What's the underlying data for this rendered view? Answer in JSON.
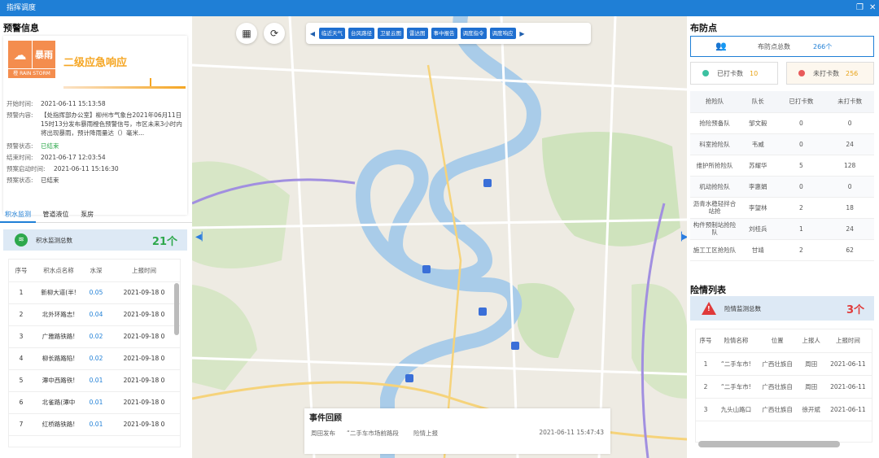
{
  "window": {
    "title": "指挥调度"
  },
  "warning": {
    "section_title": "预警信息",
    "badge_rain": "暴雨",
    "badge_level": "橙",
    "badge_caption": "RAIN STORM",
    "response_title": "二级应急响应",
    "rows": [
      {
        "label": "开始时间:",
        "value": "2021-06-11 15:13:58"
      },
      {
        "label": "预警内容:",
        "value": ""
      },
      {
        "label": "预警状态:",
        "value": "已结束"
      },
      {
        "label": "结束时间:",
        "value": "2021-06-17 12:03:54"
      },
      {
        "label": "预案启动时间:",
        "value": "2021-06-11 15:16:30"
      },
      {
        "label": "预案状态:",
        "value": "已结束"
      }
    ],
    "content": "【处指挥部办公室】柳州市气象台2021年06月11日15时13分发布暴雨橙色预警信号，市区未来3小时内将出现暴雨，预计降雨量达（）毫米..."
  },
  "tabs": [
    {
      "label": "积水监测",
      "active": true
    },
    {
      "label": "管道液位",
      "active": false
    },
    {
      "label": "泵房",
      "active": false
    }
  ],
  "water": {
    "summary_label": "积水监测总数",
    "summary_count": "21个",
    "headers": [
      "序号",
      "积水点名称",
      "水深",
      "上报时间"
    ],
    "rows": [
      [
        "1",
        "新柳大道(半!",
        "0.05",
        "2021-09-18 0"
      ],
      [
        "2",
        "北外环路志!",
        "0.04",
        "2021-09-18 0"
      ],
      [
        "3",
        "广雅路铁路!",
        "0.02",
        "2021-09-18 0"
      ],
      [
        "4",
        "柳长路路陷!",
        "0.02",
        "2021-09-18 0"
      ],
      [
        "5",
        "潭中西路铁!",
        "0.01",
        "2021-09-18 0"
      ],
      [
        "6",
        "北雀路(潭中",
        "0.01",
        "2021-09-18 0"
      ],
      [
        "7",
        "红桥路铁路!",
        "0.01",
        "2021-09-18 0"
      ]
    ]
  },
  "map": {
    "toolbar_buttons": [
      "临近天气",
      "台风路径",
      "卫星云图",
      "雷达图",
      "事中报告",
      "调度指令",
      "调度响应"
    ],
    "event": {
      "title": "事件回顾",
      "publisher": "周田发布",
      "location": "“二手车市场前路段",
      "action": "险情上报",
      "time": "2021-06-11 15:47:43"
    }
  },
  "defense": {
    "section_title": "布防点",
    "total_label": "布防点总数",
    "total_value": "266个",
    "checked_label": "已打卡数",
    "checked_value": "10",
    "unchecked_label": "未打卡数",
    "unchecked_value": "256",
    "headers": [
      "抢险队",
      "队长",
      "已打卡数",
      "未打卡数"
    ],
    "rows": [
      [
        "抢险预备队",
        "邹文毅",
        "0",
        "0"
      ],
      [
        "科室抢险队",
        "韦威",
        "0",
        "24"
      ],
      [
        "维护所抢险队",
        "苏耀华",
        "5",
        "128"
      ],
      [
        "机动抢险队",
        "李惠娟",
        "0",
        "0"
      ],
      [
        "沥青水稳轻拌合站抢",
        "李望林",
        "2",
        "18"
      ],
      [
        "构件预制站抢险队",
        "刘桂兵",
        "1",
        "24"
      ],
      [
        "施工工区抢险队",
        "甘靖",
        "2",
        "62"
      ]
    ]
  },
  "danger": {
    "section_title": "险情列表",
    "summary_label": "险情监测总数",
    "summary_count": "3个",
    "headers": [
      "序号",
      "险情名称",
      "位置",
      "上报人",
      "上报时间"
    ],
    "rows": [
      [
        "1",
        "“二手车市!",
        "广西壮族自",
        "周田",
        "2021-06-11"
      ],
      [
        "2",
        "“二手车市!",
        "广西壮族自",
        "周田",
        "2021-06-11"
      ],
      [
        "3",
        "九头山路口",
        "广西壮族自",
        "徐开斌",
        "2021-06-11"
      ]
    ]
  },
  "colors": {
    "accent": "#1f7fd6",
    "orange": "#f5a623",
    "green": "#2ea84c",
    "red": "#e03a3a"
  }
}
